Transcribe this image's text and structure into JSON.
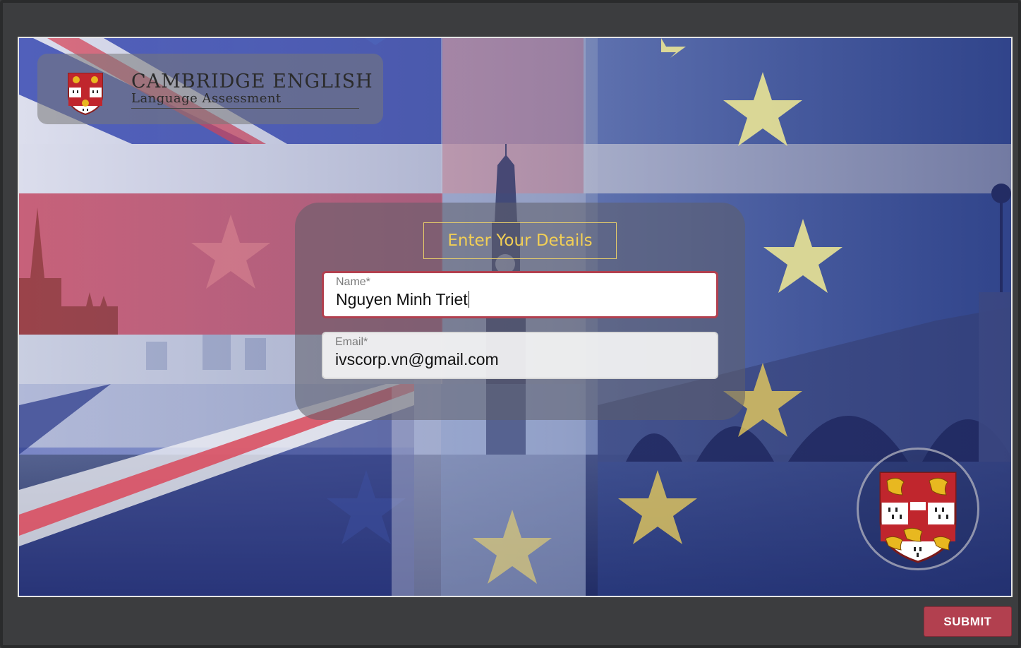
{
  "brand": {
    "title": "CAMBRIDGE ENGLISH",
    "subtitle": "Language Assessment"
  },
  "form": {
    "title": "Enter Your Details",
    "name": {
      "label": "Name*",
      "value": "Nguyen Minh Triet"
    },
    "email": {
      "label": "Email*",
      "value": "ivscorp.vn@gmail.com"
    }
  },
  "actions": {
    "submit_label": "SUBMIT"
  },
  "colors": {
    "accent": "#b2404f",
    "title_gold": "#f2cf55",
    "frame": "#3c3d3f"
  },
  "icons": {
    "logo": "cambridge-shield-icon",
    "crest": "cambridge-crest-icon"
  }
}
